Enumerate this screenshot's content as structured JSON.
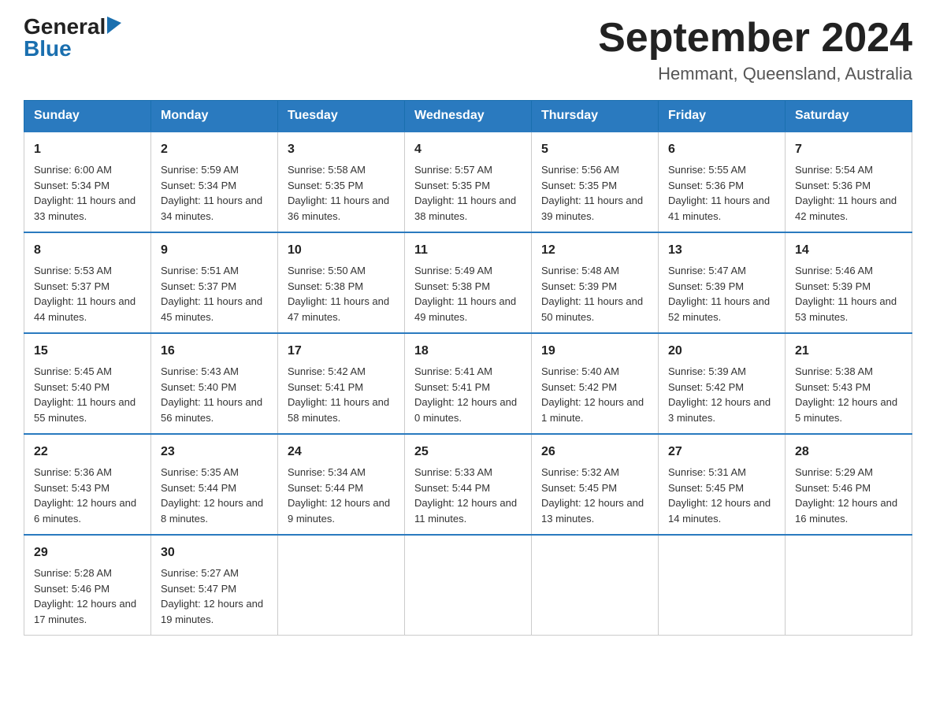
{
  "header": {
    "logo_general": "General",
    "logo_blue": "Blue",
    "title": "September 2024",
    "subtitle": "Hemmant, Queensland, Australia"
  },
  "days_of_week": [
    "Sunday",
    "Monday",
    "Tuesday",
    "Wednesday",
    "Thursday",
    "Friday",
    "Saturday"
  ],
  "weeks": [
    [
      {
        "day": "1",
        "sunrise": "6:00 AM",
        "sunset": "5:34 PM",
        "daylight": "11 hours and 33 minutes."
      },
      {
        "day": "2",
        "sunrise": "5:59 AM",
        "sunset": "5:34 PM",
        "daylight": "11 hours and 34 minutes."
      },
      {
        "day": "3",
        "sunrise": "5:58 AM",
        "sunset": "5:35 PM",
        "daylight": "11 hours and 36 minutes."
      },
      {
        "day": "4",
        "sunrise": "5:57 AM",
        "sunset": "5:35 PM",
        "daylight": "11 hours and 38 minutes."
      },
      {
        "day": "5",
        "sunrise": "5:56 AM",
        "sunset": "5:35 PM",
        "daylight": "11 hours and 39 minutes."
      },
      {
        "day": "6",
        "sunrise": "5:55 AM",
        "sunset": "5:36 PM",
        "daylight": "11 hours and 41 minutes."
      },
      {
        "day": "7",
        "sunrise": "5:54 AM",
        "sunset": "5:36 PM",
        "daylight": "11 hours and 42 minutes."
      }
    ],
    [
      {
        "day": "8",
        "sunrise": "5:53 AM",
        "sunset": "5:37 PM",
        "daylight": "11 hours and 44 minutes."
      },
      {
        "day": "9",
        "sunrise": "5:51 AM",
        "sunset": "5:37 PM",
        "daylight": "11 hours and 45 minutes."
      },
      {
        "day": "10",
        "sunrise": "5:50 AM",
        "sunset": "5:38 PM",
        "daylight": "11 hours and 47 minutes."
      },
      {
        "day": "11",
        "sunrise": "5:49 AM",
        "sunset": "5:38 PM",
        "daylight": "11 hours and 49 minutes."
      },
      {
        "day": "12",
        "sunrise": "5:48 AM",
        "sunset": "5:39 PM",
        "daylight": "11 hours and 50 minutes."
      },
      {
        "day": "13",
        "sunrise": "5:47 AM",
        "sunset": "5:39 PM",
        "daylight": "11 hours and 52 minutes."
      },
      {
        "day": "14",
        "sunrise": "5:46 AM",
        "sunset": "5:39 PM",
        "daylight": "11 hours and 53 minutes."
      }
    ],
    [
      {
        "day": "15",
        "sunrise": "5:45 AM",
        "sunset": "5:40 PM",
        "daylight": "11 hours and 55 minutes."
      },
      {
        "day": "16",
        "sunrise": "5:43 AM",
        "sunset": "5:40 PM",
        "daylight": "11 hours and 56 minutes."
      },
      {
        "day": "17",
        "sunrise": "5:42 AM",
        "sunset": "5:41 PM",
        "daylight": "11 hours and 58 minutes."
      },
      {
        "day": "18",
        "sunrise": "5:41 AM",
        "sunset": "5:41 PM",
        "daylight": "12 hours and 0 minutes."
      },
      {
        "day": "19",
        "sunrise": "5:40 AM",
        "sunset": "5:42 PM",
        "daylight": "12 hours and 1 minute."
      },
      {
        "day": "20",
        "sunrise": "5:39 AM",
        "sunset": "5:42 PM",
        "daylight": "12 hours and 3 minutes."
      },
      {
        "day": "21",
        "sunrise": "5:38 AM",
        "sunset": "5:43 PM",
        "daylight": "12 hours and 5 minutes."
      }
    ],
    [
      {
        "day": "22",
        "sunrise": "5:36 AM",
        "sunset": "5:43 PM",
        "daylight": "12 hours and 6 minutes."
      },
      {
        "day": "23",
        "sunrise": "5:35 AM",
        "sunset": "5:44 PM",
        "daylight": "12 hours and 8 minutes."
      },
      {
        "day": "24",
        "sunrise": "5:34 AM",
        "sunset": "5:44 PM",
        "daylight": "12 hours and 9 minutes."
      },
      {
        "day": "25",
        "sunrise": "5:33 AM",
        "sunset": "5:44 PM",
        "daylight": "12 hours and 11 minutes."
      },
      {
        "day": "26",
        "sunrise": "5:32 AM",
        "sunset": "5:45 PM",
        "daylight": "12 hours and 13 minutes."
      },
      {
        "day": "27",
        "sunrise": "5:31 AM",
        "sunset": "5:45 PM",
        "daylight": "12 hours and 14 minutes."
      },
      {
        "day": "28",
        "sunrise": "5:29 AM",
        "sunset": "5:46 PM",
        "daylight": "12 hours and 16 minutes."
      }
    ],
    [
      {
        "day": "29",
        "sunrise": "5:28 AM",
        "sunset": "5:46 PM",
        "daylight": "12 hours and 17 minutes."
      },
      {
        "day": "30",
        "sunrise": "5:27 AM",
        "sunset": "5:47 PM",
        "daylight": "12 hours and 19 minutes."
      },
      null,
      null,
      null,
      null,
      null
    ]
  ]
}
